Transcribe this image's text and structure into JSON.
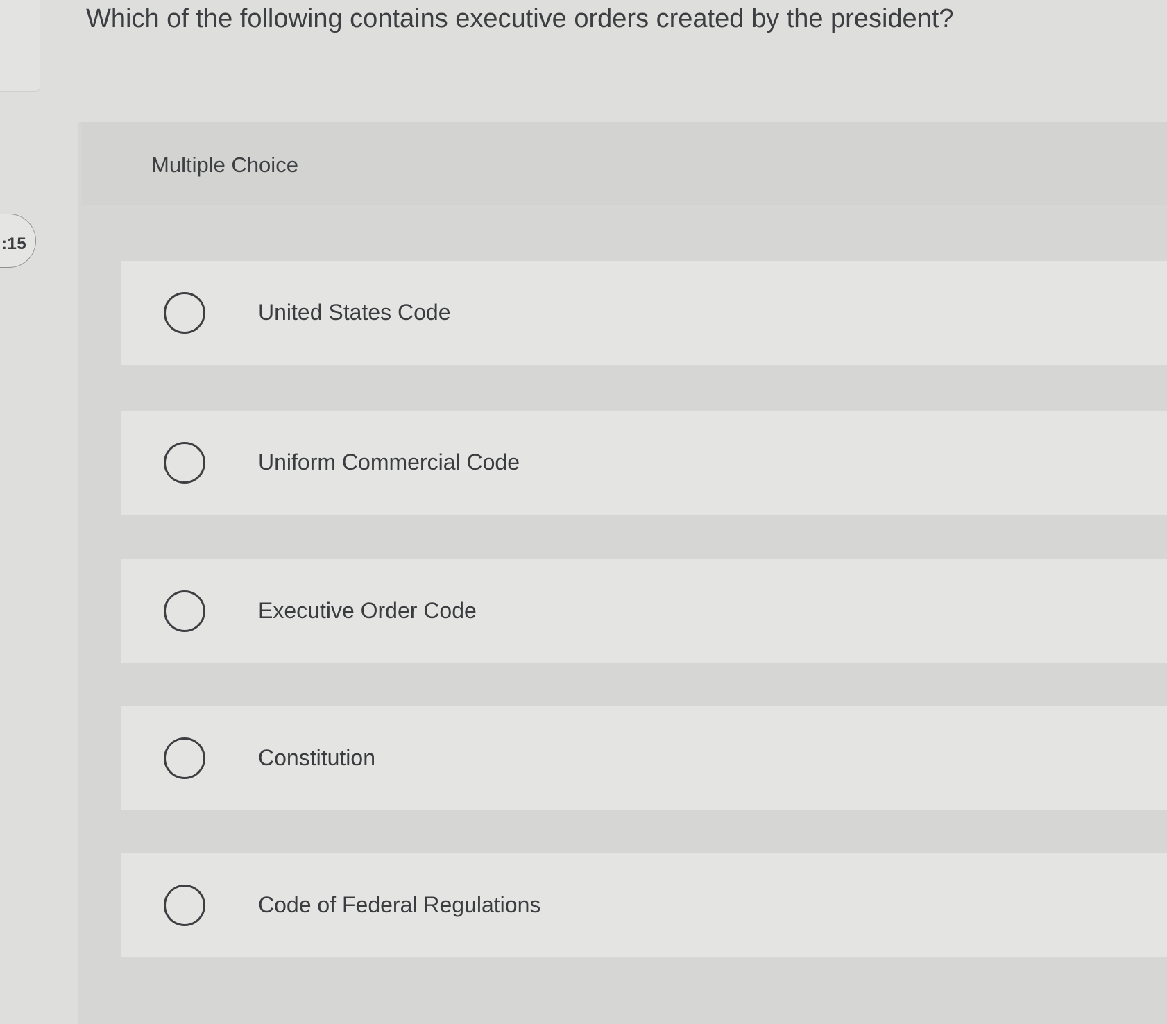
{
  "question": {
    "text": "Which of the following contains executive orders created by the president?"
  },
  "timer": {
    "text": ":15"
  },
  "quiz": {
    "type_label": "Multiple Choice",
    "options": [
      {
        "label": "United States Code"
      },
      {
        "label": "Uniform Commercial Code"
      },
      {
        "label": "Executive Order Code"
      },
      {
        "label": "Constitution"
      },
      {
        "label": "Code of Federal Regulations"
      }
    ]
  }
}
